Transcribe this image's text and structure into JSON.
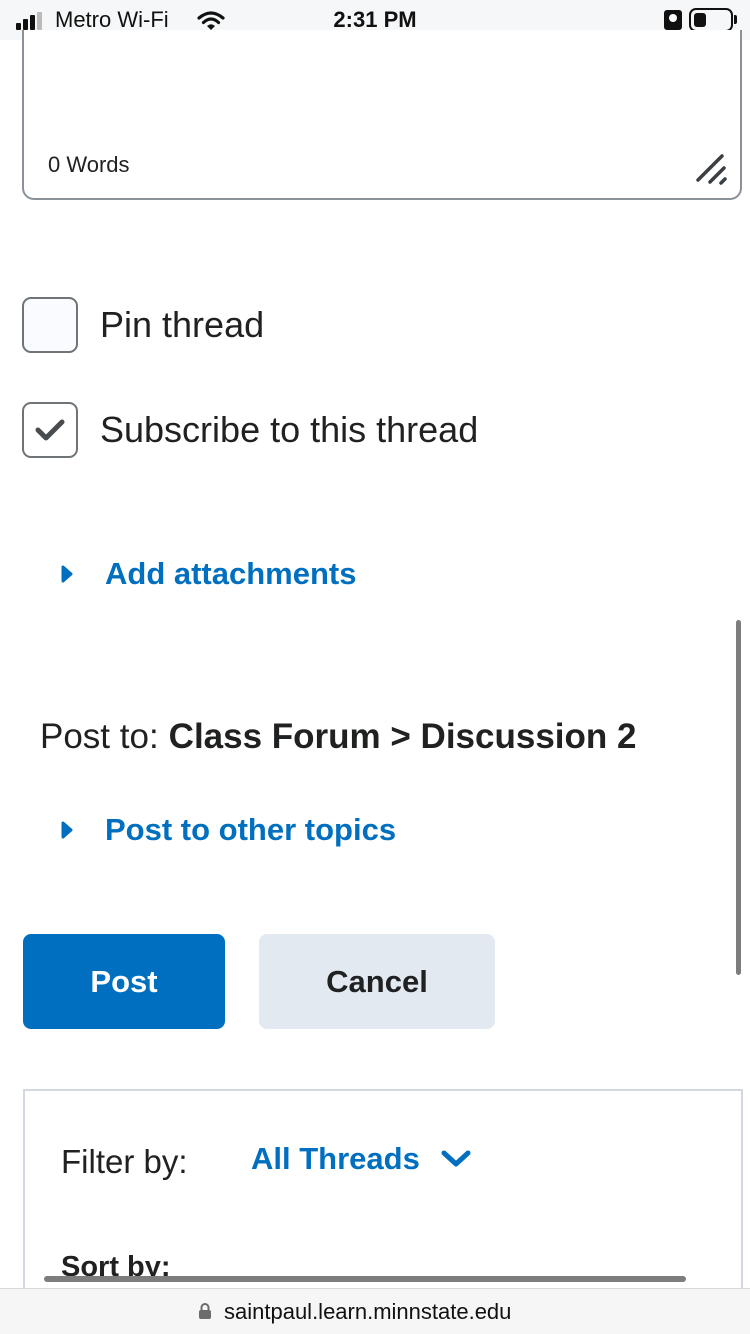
{
  "status_bar": {
    "carrier": "Metro Wi-Fi",
    "time": "2:31 PM",
    "signal_icon": "signal-bars-icon",
    "wifi_icon": "wifi-icon",
    "orientation_lock_icon": "orientation-lock-icon",
    "battery_icon": "battery-icon"
  },
  "editor": {
    "word_count": "0 Words",
    "resize_icon": "resize-handle-icon"
  },
  "options": {
    "pin_thread": {
      "label": "Pin thread",
      "checked": false
    },
    "subscribe": {
      "label": "Subscribe to this thread",
      "checked": true
    }
  },
  "attachments": {
    "label": "Add attachments",
    "icon": "caret-right-icon"
  },
  "post_to": {
    "label": "Post to:",
    "destination": "Class Forum > Discussion 2"
  },
  "other_topics": {
    "label": "Post to other topics",
    "icon": "caret-right-icon"
  },
  "buttons": {
    "post": "Post",
    "cancel": "Cancel"
  },
  "filter": {
    "label": "Filter by:",
    "value": "All Threads",
    "sort_label": "Sort by:",
    "chevron_icon": "chevron-down-icon"
  },
  "browser": {
    "url": "saintpaul.learn.minnstate.edu",
    "lock_icon": "lock-icon"
  },
  "colors": {
    "accent": "#006fbf",
    "cancel_bg": "#e3e9f1",
    "text": "#202122"
  }
}
